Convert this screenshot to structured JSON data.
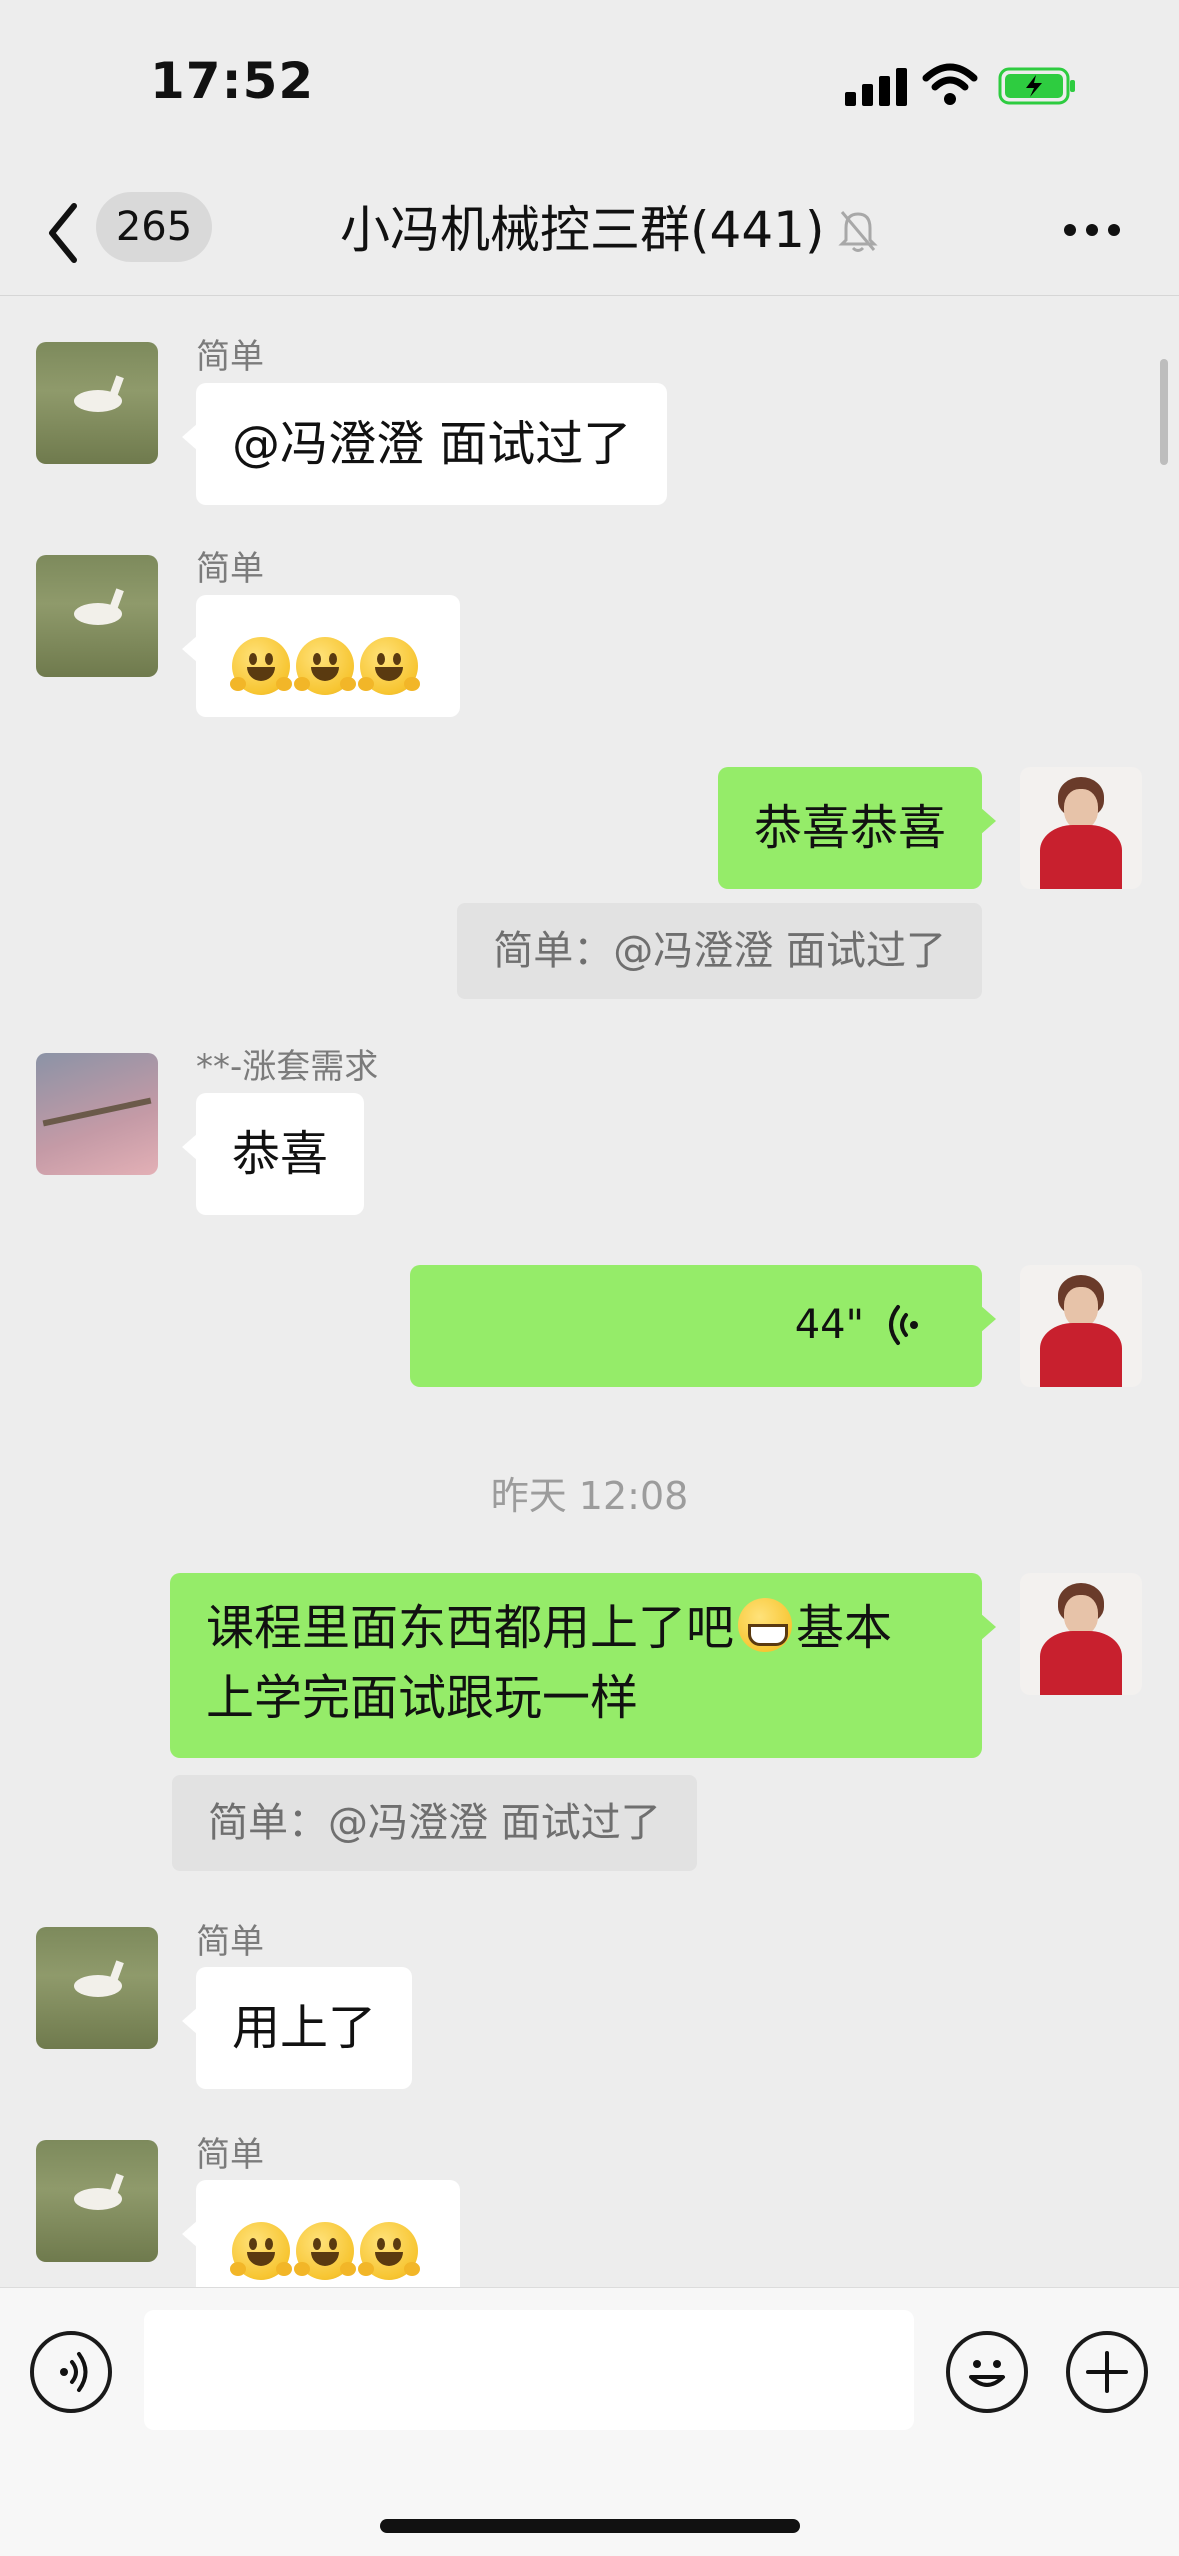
{
  "status_bar": {
    "time": "17:52",
    "signal_icon": "cellular-signal-icon",
    "wifi_icon": "wifi-icon",
    "battery_icon": "battery-charging-icon",
    "battery_color": "#2ecc40"
  },
  "nav": {
    "back_icon": "chevron-left-icon",
    "unread_count": "265",
    "title": "小冯机械控三群(441)",
    "mute_icon": "bell-muted-icon",
    "more_icon": "more-dots-icon"
  },
  "messages": [
    {
      "side": "left",
      "sender": "简单",
      "text": "@冯澄澄 面试过了",
      "avatar": "peacock-avatar"
    },
    {
      "side": "left",
      "sender": "简单",
      "emoji": "smiling-hands-emoji",
      "emoji_count": 3,
      "avatar": "peacock-avatar"
    },
    {
      "side": "right",
      "text": "恭喜恭喜",
      "quote": "简单：@冯澄澄 面试过了",
      "avatar": "woman-red-avatar"
    },
    {
      "side": "left",
      "sender": "**-涨套需求",
      "text": "恭喜",
      "avatar": "branch-avatar"
    },
    {
      "side": "right",
      "voice_duration": "44\"",
      "voice_icon": "voice-wave-icon",
      "avatar": "woman-red-avatar"
    },
    {
      "timestamp": "昨天 12:08"
    },
    {
      "side": "right",
      "text_line1_a": "课程里面东西都用上了吧",
      "text_line1_b": "基本",
      "text_line2": "上学完面试跟玩一样",
      "inline_emoji": "grinning-emoji",
      "quote": "简单：@冯澄澄 面试过了",
      "avatar": "woman-red-avatar"
    },
    {
      "side": "left",
      "sender": "简单",
      "text": "用上了",
      "avatar": "peacock-avatar"
    },
    {
      "side": "left",
      "sender": "简单",
      "emoji": "smiling-hands-emoji",
      "emoji_count": 3,
      "avatar": "peacock-avatar"
    }
  ],
  "input_bar": {
    "voice_button_icon": "voice-input-icon",
    "text_value": "",
    "emoji_button_icon": "emoji-smile-icon",
    "plus_button_icon": "plus-icon"
  },
  "colors": {
    "background": "#ededed",
    "self_bubble": "#95ec69",
    "other_bubble": "#ffffff"
  }
}
